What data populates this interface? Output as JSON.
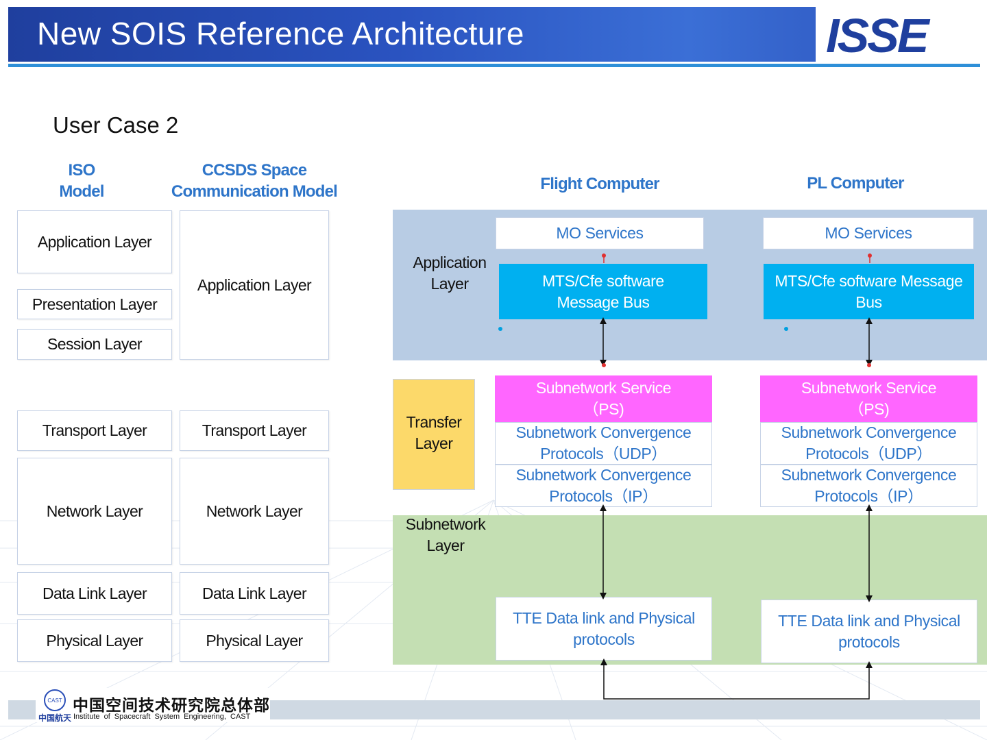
{
  "header": {
    "title": "New SOIS Reference Architecture",
    "logo_text": "ISSE"
  },
  "case_title": "User Case 2",
  "iso": {
    "header": [
      "ISO",
      "Model"
    ],
    "layers": [
      "Application Layer",
      "Presentation Layer",
      "Session Layer",
      "Transport Layer",
      "Network Layer",
      "Data Link Layer",
      "Physical Layer"
    ]
  },
  "ccsds": {
    "header": [
      "CCSDS Space",
      "Communication Model"
    ],
    "layers": [
      "Application Layer",
      "Transport Layer",
      "Network Layer",
      "Data Link Layer",
      "Physical Layer"
    ]
  },
  "bands": {
    "application": [
      "Application",
      "Layer"
    ],
    "transfer": [
      "Transfer",
      "Layer"
    ],
    "subnetwork": [
      "Subnetwork",
      "Layer"
    ]
  },
  "flight": {
    "header": "Flight Computer",
    "mo_services": "MO Services",
    "bus": [
      "MTS/Cfe software",
      "Message Bus"
    ],
    "subnet_service": [
      "Subnetwork Service",
      "（PS)"
    ],
    "udp": [
      "Subnetwork Convergence",
      "Protocols（UDP）"
    ],
    "ip": [
      "Subnetwork Convergence",
      "Protocols（IP）"
    ],
    "tte": [
      "TTE Data link and Physical",
      "protocols"
    ]
  },
  "pl": {
    "header": "PL Computer",
    "mo_services": "MO Services",
    "bus": [
      "MTS/Cfe software Message",
      "Bus"
    ],
    "subnet_service": [
      "Subnetwork Service",
      "（PS)"
    ],
    "udp": [
      "Subnetwork Convergence",
      "Protocols（UDP）"
    ],
    "ip": [
      "Subnetwork Convergence",
      "Protocols（IP）"
    ],
    "tte": [
      "TTE Data link and Physical",
      "protocols"
    ]
  },
  "footer": {
    "org_cn": "中国空间技术研究院总体部",
    "org_en": "Institute of Spacecraft System Engineering, CAST",
    "brand_cn": "中国航天",
    "emblem_text": "CAST"
  },
  "colors": {
    "header": "#2a53c0",
    "accent_text": "#2e75c9",
    "application_band": "#b8cce4",
    "transfer_band": "#fcd96a",
    "subnetwork_band": "#c4dfb3",
    "bus_box": "#00b0f0",
    "service_box": "#ff66ff"
  }
}
